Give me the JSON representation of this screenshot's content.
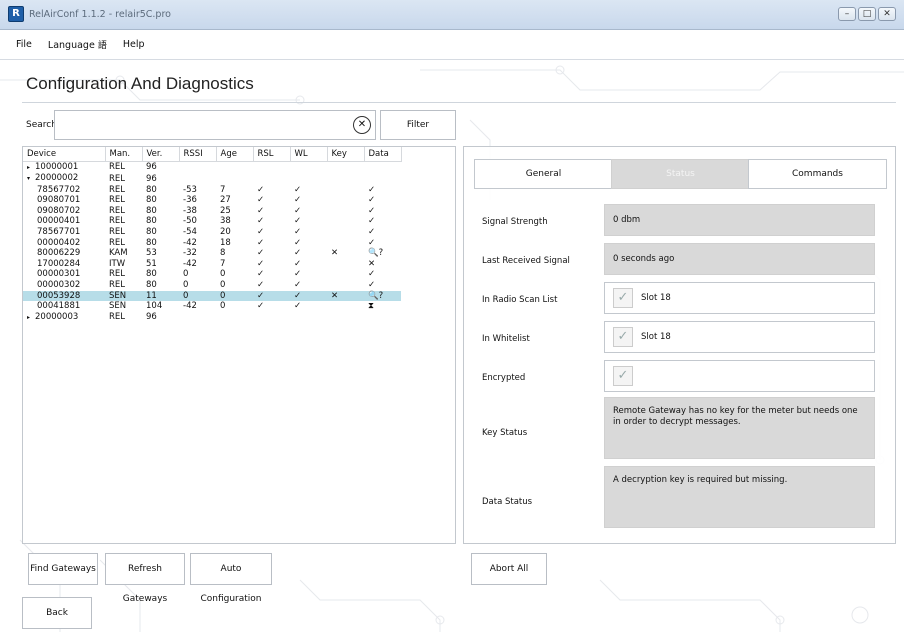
{
  "window": {
    "title": "RelAirConf 1.1.2 - relair5C.pro",
    "icon": "app-icon",
    "buttons": [
      "minimize-icon",
      "maximize-icon",
      "close-icon"
    ]
  },
  "menu": {
    "file": "File",
    "language": "Language",
    "language_icon": "language-icon",
    "help": "Help"
  },
  "page_title": "Configuration And Diagnostics",
  "search": {
    "label": "Search",
    "value": "",
    "filter_label": "Filter"
  },
  "table": {
    "headers": [
      "Device",
      "Man.",
      "Ver.",
      "RSSI",
      "Age",
      "RSL",
      "WL",
      "Key",
      "Data"
    ],
    "rows": [
      {
        "device": "10000001",
        "man": "REL",
        "ver": "96",
        "rssi": "",
        "age": "",
        "rsl": "",
        "wl": "",
        "key": "",
        "data": "",
        "level": 0,
        "expander": "▸"
      },
      {
        "device": "20000002",
        "man": "REL",
        "ver": "96",
        "rssi": "",
        "age": "",
        "rsl": "",
        "wl": "",
        "key": "",
        "data": "",
        "level": 0,
        "expander": "▾"
      },
      {
        "device": "78567702",
        "man": "REL",
        "ver": "80",
        "rssi": "-53",
        "age": "7",
        "rsl": "✓",
        "wl": "✓",
        "key": "",
        "data": "✓",
        "level": 1
      },
      {
        "device": "09080701",
        "man": "REL",
        "ver": "80",
        "rssi": "-36",
        "age": "27",
        "rsl": "✓",
        "wl": "✓",
        "key": "",
        "data": "✓",
        "level": 1
      },
      {
        "device": "09080702",
        "man": "REL",
        "ver": "80",
        "rssi": "-38",
        "age": "25",
        "rsl": "✓",
        "wl": "✓",
        "key": "",
        "data": "✓",
        "level": 1
      },
      {
        "device": "00000401",
        "man": "REL",
        "ver": "80",
        "rssi": "-50",
        "age": "38",
        "rsl": "✓",
        "wl": "✓",
        "key": "",
        "data": "✓",
        "level": 1
      },
      {
        "device": "78567701",
        "man": "REL",
        "ver": "80",
        "rssi": "-54",
        "age": "20",
        "rsl": "✓",
        "wl": "✓",
        "key": "",
        "data": "✓",
        "level": 1
      },
      {
        "device": "00000402",
        "man": "REL",
        "ver": "80",
        "rssi": "-42",
        "age": "18",
        "rsl": "✓",
        "wl": "✓",
        "key": "",
        "data": "✓",
        "level": 1
      },
      {
        "device": "80006229",
        "man": "KAM",
        "ver": "53",
        "rssi": "-32",
        "age": "8",
        "rsl": "✓",
        "wl": "✓",
        "key": "✕",
        "data": "🔍?",
        "level": 1
      },
      {
        "device": "17000284",
        "man": "ITW",
        "ver": "51",
        "rssi": "-42",
        "age": "7",
        "rsl": "✓",
        "wl": "✓",
        "key": "",
        "data": "✕",
        "level": 1
      },
      {
        "device": "00000301",
        "man": "REL",
        "ver": "80",
        "rssi": "0",
        "age": "0",
        "rsl": "✓",
        "wl": "✓",
        "key": "",
        "data": "✓",
        "level": 1
      },
      {
        "device": "00000302",
        "man": "REL",
        "ver": "80",
        "rssi": "0",
        "age": "0",
        "rsl": "✓",
        "wl": "✓",
        "key": "",
        "data": "✓",
        "level": 1
      },
      {
        "device": "00053928",
        "man": "SEN",
        "ver": "11",
        "rssi": "0",
        "age": "0",
        "rsl": "✓",
        "wl": "✓",
        "key": "✕",
        "data": "🔍?",
        "level": 1,
        "selected": true
      },
      {
        "device": "00041881",
        "man": "SEN",
        "ver": "104",
        "rssi": "-42",
        "age": "0",
        "rsl": "✓",
        "wl": "✓",
        "key": "",
        "data": "⧗",
        "level": 1
      },
      {
        "device": "20000003",
        "man": "REL",
        "ver": "96",
        "rssi": "",
        "age": "",
        "rsl": "",
        "wl": "",
        "key": "",
        "data": "",
        "level": 0,
        "expander": "▸"
      }
    ]
  },
  "tabs": [
    {
      "label": "General",
      "active": false
    },
    {
      "label": "Status",
      "active": true
    },
    {
      "label": "Commands",
      "active": false
    }
  ],
  "status": {
    "signal_strength_label": "Signal Strength",
    "signal_strength_value": "0 dbm",
    "last_received_label": "Last Received Signal",
    "last_received_value": "0 seconds ago",
    "radio_scan_label": "In Radio Scan List",
    "radio_scan_value": "Slot 18",
    "radio_scan_checked": true,
    "whitelist_label": "In Whitelist",
    "whitelist_value": "Slot 18",
    "whitelist_checked": true,
    "encrypted_label": "Encrypted",
    "encrypted_checked": true,
    "key_status_label": "Key Status",
    "key_status_value": "Remote Gateway has no key for the meter but needs one in order to decrypt messages.",
    "data_status_label": "Data Status",
    "data_status_value": "A decryption key is required but missing."
  },
  "buttons": {
    "find_gateways": "Find Gateways",
    "refresh_gateways": "Refresh Gateways",
    "auto_configuration": "Auto Configuration",
    "abort_all": "Abort All",
    "back": "Back"
  },
  "colors": {
    "selected_row": "#b7dde8",
    "status_box": "#d9d9d9",
    "art_lines": "#e6e8ec"
  }
}
